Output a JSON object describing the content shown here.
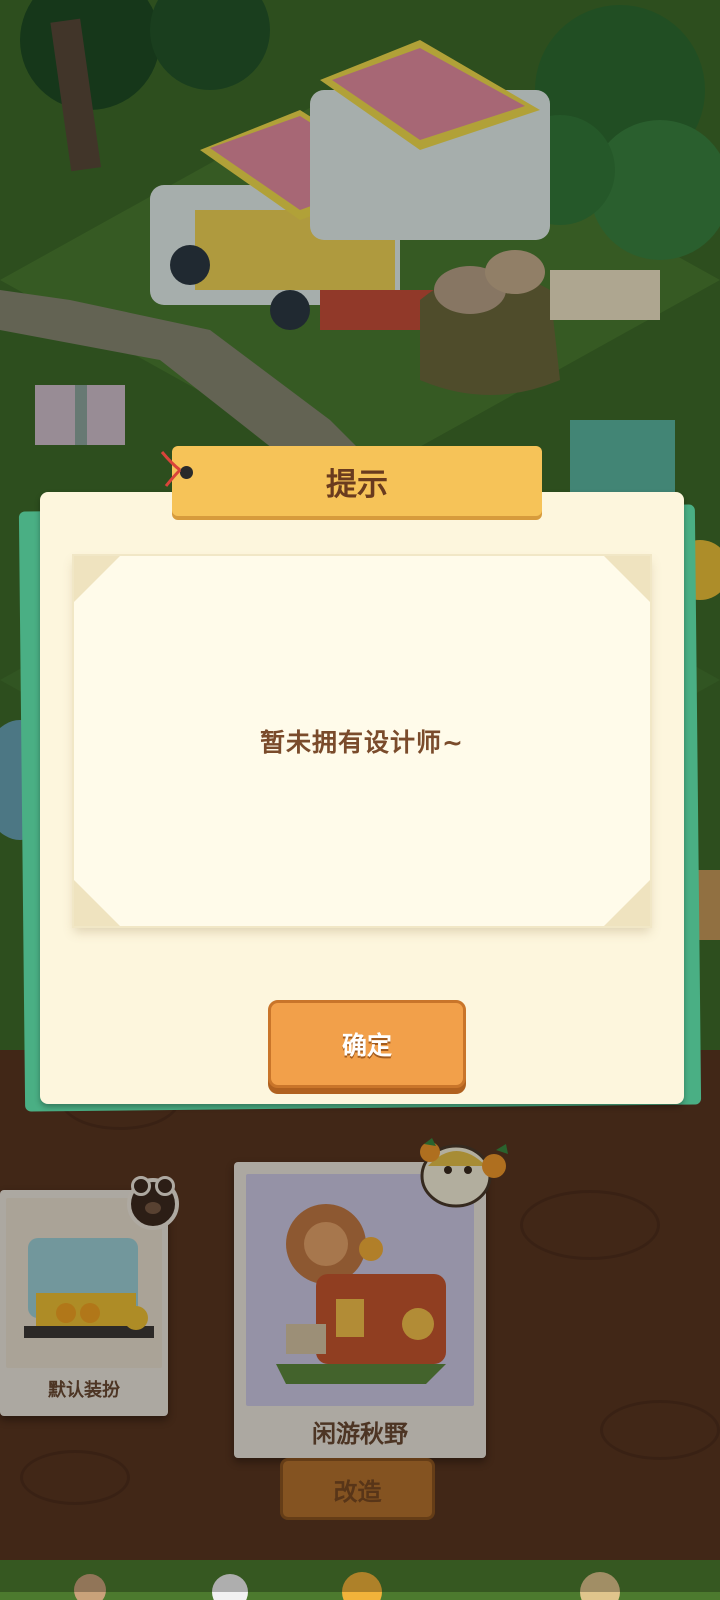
{
  "dialog": {
    "title": "提示",
    "message": "暂未拥有设计师~",
    "confirm_label": "确定"
  },
  "outfits": [
    {
      "label": "默认装扮"
    },
    {
      "label": "闲游秋野"
    }
  ],
  "modify_label": "改造",
  "colors": {
    "dialog_bg": "#fdf6dd",
    "title_tab": "#f6c358",
    "confirm_button": "#f2a04a",
    "panel_accent": "#4aaf84",
    "wood_panel": "#5a3620"
  },
  "icons": [
    "bear-badge-icon",
    "orange-bird-icon"
  ]
}
